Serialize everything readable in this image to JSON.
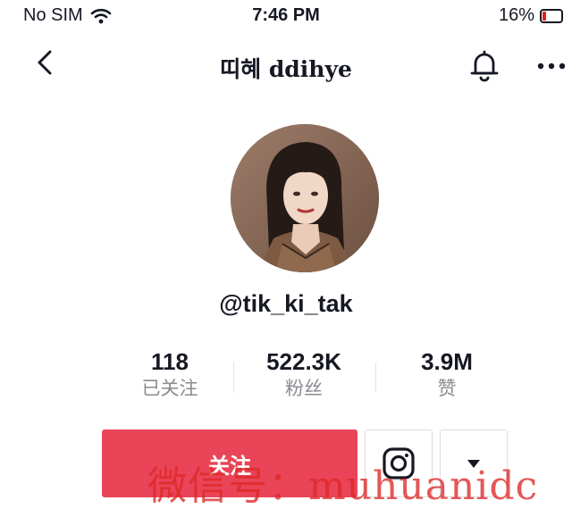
{
  "status_bar": {
    "carrier": "No SIM",
    "time": "7:46 PM",
    "battery": "16%"
  },
  "header": {
    "title": "띠혜 ddihye",
    "back_icon": "chevron-left-icon",
    "bell_icon": "bell-icon",
    "more_icon": "more-horizontal-icon"
  },
  "profile": {
    "handle": "@tik_ki_tak"
  },
  "stats": [
    {
      "value": "118",
      "label": "已关注"
    },
    {
      "value": "522.3K",
      "label": "粉丝"
    },
    {
      "value": "3.9M",
      "label": "赞"
    }
  ],
  "actions": {
    "follow_label": "关注",
    "instagram_icon": "instagram-icon",
    "dropdown_icon": "caret-down-icon"
  },
  "watermark": "微信号：muhuanidc",
  "colors": {
    "accent": "#ea4458",
    "text": "#161823",
    "muted": "#8a8b91"
  }
}
